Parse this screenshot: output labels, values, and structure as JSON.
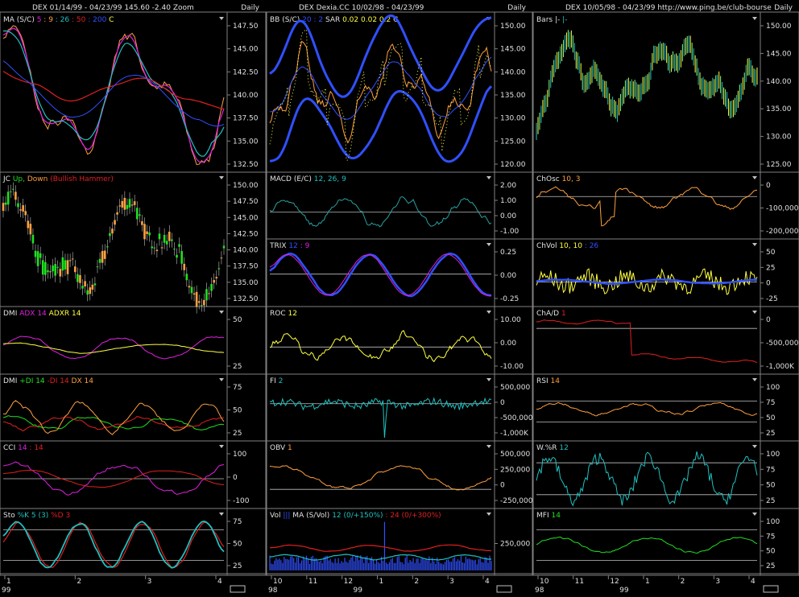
{
  "colors": {
    "background": "#000000",
    "frame": "#808080",
    "text": "#e0e0e0",
    "orange": "#ffa040",
    "yellow": "#ffff40",
    "blue": "#3050ff",
    "cyan": "#20c0c0",
    "magenta": "#e020e0",
    "red": "#e02020",
    "green": "#20e020",
    "teal": "#2aa0a0"
  },
  "columns": [
    {
      "id": "left",
      "header": {
        "symbol": "DEX",
        "dates": "01/14/99 - 04/23/99",
        "last": "145.60",
        "change": "-2.40",
        "extra": "Zoom",
        "period": "Daily"
      },
      "x_axis": {
        "ticks": [
          "1",
          "2",
          "3",
          "4"
        ],
        "year": "99"
      },
      "panels": [
        {
          "id": "ma",
          "label": [
            {
              "t": "MA (S/C)",
              "c": "text"
            },
            {
              "t": "5",
              "c": "magenta"
            },
            {
              "t": ": 9",
              "c": "orange"
            },
            {
              "t": ": 26",
              "c": "cyan"
            },
            {
              "t": ": 50",
              "c": "red"
            },
            {
              "t": ": 200",
              "c": "blue"
            },
            {
              "t": "C",
              "c": "yellow"
            }
          ],
          "scale": [
            "147.50",
            "145.00",
            "142.50",
            "140.00",
            "137.50",
            "135.00",
            "132.50"
          ]
        },
        {
          "id": "jc",
          "label": [
            {
              "t": "JC",
              "c": "text"
            },
            {
              "t": "Up,",
              "c": "green"
            },
            {
              "t": "Down",
              "c": "orange"
            },
            {
              "t": "(Bullish Hammer)",
              "c": "red"
            }
          ],
          "scale": [
            "150.00",
            "147.50",
            "145.00",
            "142.50",
            "140.00",
            "137.50",
            "135.00",
            "132.50"
          ]
        },
        {
          "id": "dmi1",
          "label": [
            {
              "t": "DMI",
              "c": "text"
            },
            {
              "t": "ADX 14",
              "c": "magenta"
            },
            {
              "t": "ADXR 14",
              "c": "yellow"
            }
          ],
          "scale": [
            "50",
            "25"
          ]
        },
        {
          "id": "dmi2",
          "label": [
            {
              "t": "DMI",
              "c": "text"
            },
            {
              "t": "+DI 14",
              "c": "green"
            },
            {
              "t": "-DI 14",
              "c": "red"
            },
            {
              "t": "DX 14",
              "c": "orange"
            }
          ],
          "scale": [
            "75",
            "50",
            "25"
          ]
        },
        {
          "id": "cci",
          "label": [
            {
              "t": "CCI",
              "c": "text"
            },
            {
              "t": "14",
              "c": "magenta"
            },
            {
              "t": ": 14",
              "c": "red"
            }
          ],
          "scale": [
            "100",
            "0",
            "-100"
          ]
        },
        {
          "id": "sto",
          "label": [
            {
              "t": "Sto",
              "c": "text"
            },
            {
              "t": "%K 5 (3)",
              "c": "cyan"
            },
            {
              "t": "%D 3",
              "c": "red"
            }
          ],
          "scale": [
            "75",
            "50",
            "25"
          ]
        }
      ]
    },
    {
      "id": "middle",
      "header": {
        "symbol": "DEX",
        "dates": "Dexia.CC  10/02/98 - 04/23/99",
        "last": "",
        "change": "",
        "extra": "",
        "period": "Daily"
      },
      "x_axis": {
        "ticks": [
          "10",
          "11",
          "12",
          "1",
          "2",
          "3",
          "4"
        ],
        "year": "98",
        "year2": "99"
      },
      "panels": [
        {
          "id": "bb",
          "label": [
            {
              "t": "BB (S/C)",
              "c": "text"
            },
            {
              "t": "20",
              "c": "blue"
            },
            {
              "t": ": 2",
              "c": "blue"
            },
            {
              "t": "SAR",
              "c": "text"
            },
            {
              "t": "0.02",
              "c": "yellow"
            },
            {
              "t": "0.02",
              "c": "yellow"
            },
            {
              "t": "0.2",
              "c": "yellow"
            },
            {
              "t": "C",
              "c": "text"
            }
          ],
          "scale": [
            "150.00",
            "145.00",
            "140.00",
            "135.00",
            "130.00",
            "125.00",
            "120.00"
          ]
        },
        {
          "id": "macd",
          "label": [
            {
              "t": "MACD (E/C)",
              "c": "text"
            },
            {
              "t": "12, 26, 9",
              "c": "cyan"
            }
          ],
          "scale": [
            "2.00",
            "1.00",
            "0.00",
            "-1.00"
          ]
        },
        {
          "id": "trix",
          "label": [
            {
              "t": "TRIX",
              "c": "text"
            },
            {
              "t": "12",
              "c": "blue"
            },
            {
              "t": ": 9",
              "c": "magenta"
            }
          ],
          "scale": [
            "0.25",
            "0.00",
            "-0.25"
          ]
        },
        {
          "id": "roc",
          "label": [
            {
              "t": "ROC",
              "c": "text"
            },
            {
              "t": "12",
              "c": "yellow"
            }
          ],
          "scale": [
            "10.00",
            "0.00",
            "-10.00"
          ]
        },
        {
          "id": "fi",
          "label": [
            {
              "t": "FI",
              "c": "text"
            },
            {
              "t": "2",
              "c": "cyan"
            }
          ],
          "scale": [
            "500,000",
            "0",
            "-500,000",
            "-1,000K"
          ]
        },
        {
          "id": "obv",
          "label": [
            {
              "t": "OBV",
              "c": "text"
            },
            {
              "t": "1",
              "c": "orange"
            }
          ],
          "scale": [
            "500,000",
            "250,000",
            "0",
            "-250,000"
          ]
        },
        {
          "id": "vol",
          "label": [
            {
              "t": "Vol",
              "c": "text"
            },
            {
              "t": "|||",
              "c": "blue"
            },
            {
              "t": "MA (S/Vol)",
              "c": "text"
            },
            {
              "t": "12 (0/+150%)",
              "c": "cyan"
            },
            {
              "t": ": 24 (0/+300%)",
              "c": "red"
            }
          ],
          "scale": [
            "250,000"
          ]
        }
      ]
    },
    {
      "id": "right",
      "header": {
        "symbol": "DEX",
        "dates": "10/05/98 - 04/23/99",
        "last": "",
        "change": "",
        "extra": "http://www.ping.be/club-bourse",
        "period": "Daily"
      },
      "x_axis": {
        "ticks": [
          "10",
          "11",
          "12",
          "1",
          "2",
          "3",
          "4"
        ],
        "year": "98",
        "year2": "99"
      },
      "panels": [
        {
          "id": "bars",
          "label": [
            {
              "t": "Bars",
              "c": "text"
            },
            {
              "t": "|-",
              "c": "text"
            },
            {
              "t": "|-",
              "c": "cyan"
            }
          ],
          "scale": [
            "150.00",
            "145.00",
            "140.00",
            "135.00",
            "130.00",
            "125.00"
          ]
        },
        {
          "id": "chosc",
          "label": [
            {
              "t": "ChOsc",
              "c": "text"
            },
            {
              "t": "10, 3",
              "c": "orange"
            }
          ],
          "scale": [
            "0",
            "-100,000",
            "-200,000"
          ]
        },
        {
          "id": "chvol",
          "label": [
            {
              "t": "ChVol",
              "c": "text"
            },
            {
              "t": "10, 10",
              "c": "yellow"
            },
            {
              "t": ": 26",
              "c": "blue"
            }
          ],
          "scale": [
            "50",
            "25",
            "0",
            "-25"
          ]
        },
        {
          "id": "chad",
          "label": [
            {
              "t": "ChA/D",
              "c": "text"
            },
            {
              "t": "1",
              "c": "red"
            }
          ],
          "scale": [
            "0",
            "-500,000",
            "-1,000K"
          ]
        },
        {
          "id": "rsi",
          "label": [
            {
              "t": "RSI",
              "c": "text"
            },
            {
              "t": "14",
              "c": "orange"
            }
          ],
          "scale": [
            "100",
            "75",
            "50",
            "25"
          ]
        },
        {
          "id": "wr",
          "label": [
            {
              "t": "W.%R",
              "c": "text"
            },
            {
              "t": "12",
              "c": "cyan"
            }
          ],
          "scale": [
            "100",
            "75",
            "50",
            "25"
          ]
        },
        {
          "id": "mfi",
          "label": [
            {
              "t": "MFI",
              "c": "text"
            },
            {
              "t": "14",
              "c": "green"
            }
          ],
          "scale": [
            "100",
            "75",
            "50",
            "25"
          ]
        }
      ]
    }
  ]
}
